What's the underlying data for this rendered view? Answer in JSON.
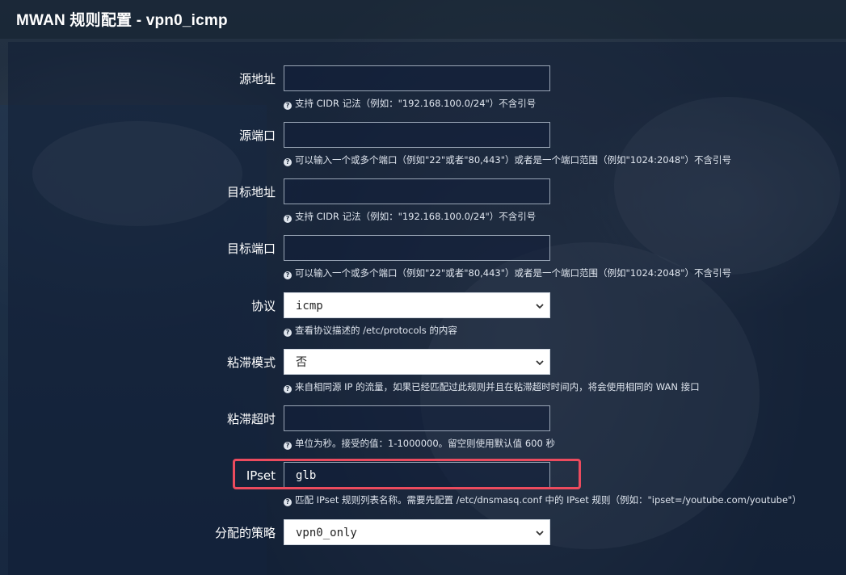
{
  "page": {
    "title": "MWAN 规则配置 - vpn0_icmp"
  },
  "fields": [
    {
      "label": "源地址",
      "type": "text",
      "value": "",
      "hint": "支持 CIDR 记法（例如：\"192.168.100.0/24\"）不含引号"
    },
    {
      "label": "源端口",
      "type": "text",
      "value": "",
      "hint": "可以输入一个或多个端口（例如\"22\"或者\"80,443\"）或者是一个端口范围（例如\"1024:2048\"）不含引号"
    },
    {
      "label": "目标地址",
      "type": "text",
      "value": "",
      "hint": "支持 CIDR 记法（例如：\"192.168.100.0/24\"）不含引号"
    },
    {
      "label": "目标端口",
      "type": "text",
      "value": "",
      "hint": "可以输入一个或多个端口（例如\"22\"或者\"80,443\"）或者是一个端口范围（例如\"1024:2048\"）不含引号"
    },
    {
      "label": "协议",
      "type": "select",
      "value": "icmp",
      "hint": "查看协议描述的 /etc/protocols 的内容"
    },
    {
      "label": "粘滞模式",
      "type": "select",
      "value": "否",
      "hint": "来自相同源 IP 的流量，如果已经匹配过此规则并且在粘滞超时时间内，将会使用相同的 WAN 接口"
    },
    {
      "label": "粘滞超时",
      "type": "text",
      "value": "",
      "hint": "单位为秒。接受的值：1-1000000。留空则使用默认值 600 秒"
    },
    {
      "label": "IPset",
      "type": "text",
      "value": "glb",
      "hint": "匹配 IPset 规则列表名称。需要先配置 /etc/dnsmasq.conf 中的 IPset 规则（例如：\"ipset=/youtube.com/youtube\"）"
    },
    {
      "label": "分配的策略",
      "type": "select",
      "value": "vpn0_only",
      "hint": ""
    }
  ],
  "icons": {
    "help": "help-circle-icon",
    "dropdown": "chevron-down-icon"
  },
  "help_glyph": "?",
  "colors": {
    "highlight": "#ec4b5e"
  }
}
